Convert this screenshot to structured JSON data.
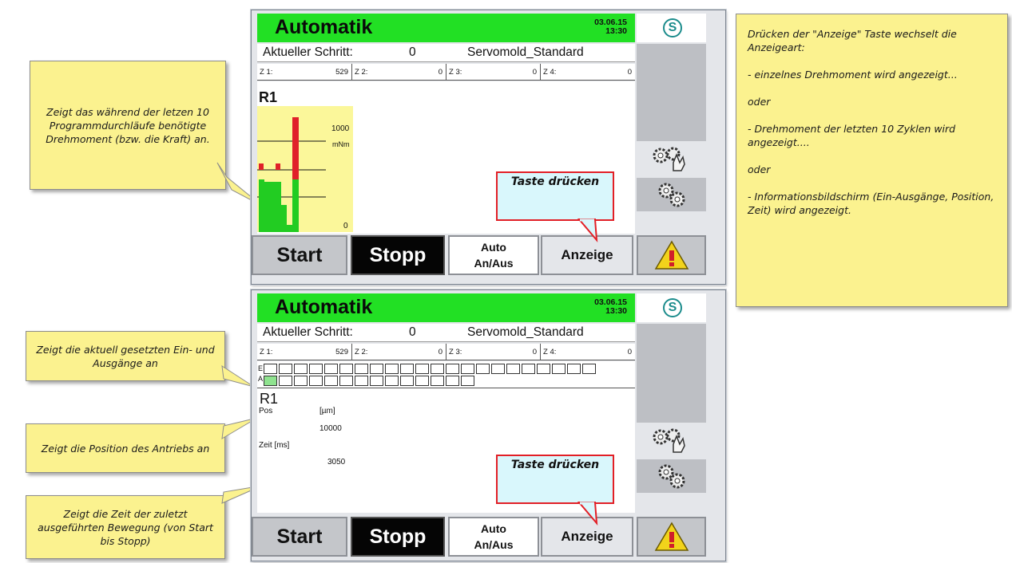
{
  "screen1": {
    "title": "Automatik",
    "date": "03.06.15",
    "time": "13:30",
    "logo_symbol": "S",
    "step_label": "Aktueller Schritt:",
    "step_value": "0",
    "program": "Servomold_Standard",
    "counters": [
      {
        "label": "Z 1:",
        "value": "529"
      },
      {
        "label": "Z 2:",
        "value": "0"
      },
      {
        "label": "Z 3:",
        "value": "0"
      },
      {
        "label": "Z 4:",
        "value": "0"
      }
    ],
    "drive_label": "R1",
    "chart": {
      "max_label": "1000",
      "unit": "mNm",
      "min_label": "0"
    },
    "callout": "Taste drücken",
    "buttons": {
      "start": "Start",
      "stop": "Stopp",
      "auto_line1": "Auto",
      "auto_line2": "An/Aus",
      "display": "Anzeige"
    }
  },
  "screen2": {
    "title": "Automatik",
    "date": "03.06.15",
    "time": "13:30",
    "logo_symbol": "S",
    "step_label": "Aktueller Schritt:",
    "step_value": "0",
    "program": "Servomold_Standard",
    "counters": [
      {
        "label": "Z 1:",
        "value": "529"
      },
      {
        "label": "Z 2:",
        "value": "0"
      },
      {
        "label": "Z 3:",
        "value": "0"
      },
      {
        "label": "Z 4:",
        "value": "0"
      }
    ],
    "io": {
      "e_label": "E",
      "a_label": "A"
    },
    "drive_label": "R1",
    "pos_label": "Pos",
    "pos_unit": "[µm]",
    "pos_value": "10000",
    "time_label": "Zeit [ms]",
    "time_value": "3050",
    "callout": "Taste drücken",
    "buttons": {
      "start": "Start",
      "stop": "Stopp",
      "auto_line1": "Auto",
      "auto_line2": "An/Aus",
      "display": "Anzeige"
    }
  },
  "notes": {
    "torque": "Zeigt das während der letzen 10 Programmdurchläufe benötigte Drehmoment (bzw. die Kraft) an.",
    "io": "Zeigt die aktuell gesetzten Ein- und Ausgänge an",
    "position": "Zeigt die Position des Antriebs an",
    "time": "Zeigt die Zeit der zuletzt ausgeführten Bewegung (von Start bis Stopp)"
  },
  "right_note": {
    "p1": "Drücken der \"Anzeige\" Taste wechselt die Anzeigeart:",
    "p2": "- einzelnes Drehmoment wird angezeigt...",
    "p3": "oder",
    "p4": "- Drehmoment der letzten 10 Zyklen wird angezeigt....",
    "p5": "oder",
    "p6": "- Informationsbildschirm (Ein-Ausgänge, Position, Zeit) wird angezeigt."
  },
  "colors": {
    "title_green": "#22e024",
    "chart_yellow": "#fbf79a",
    "bar_green": "#22cc22",
    "bar_red": "#e0202a",
    "note_yellow": "#fbf28f",
    "callout_blue": "#d9f7fc",
    "callout_border": "#e21f26"
  },
  "icons": {
    "settings_hand": "gears-hand-icon",
    "settings": "gears-icon",
    "warning": "warning-triangle-icon",
    "logo": "logo-icon"
  }
}
